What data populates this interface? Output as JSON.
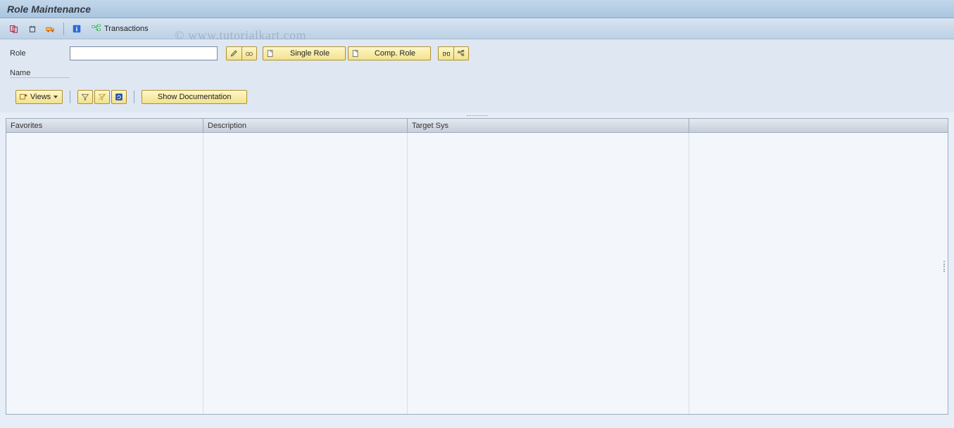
{
  "header": {
    "title": "Role Maintenance"
  },
  "toolbar": {
    "transactions_label": "Transactions"
  },
  "form": {
    "role_label": "Role",
    "role_value": "",
    "name_label": "Name",
    "single_role_label": "Single Role",
    "comp_role_label": "Comp. Role"
  },
  "sec_toolbar": {
    "views_label": "Views",
    "show_documentation_label": "Show Documentation"
  },
  "grid": {
    "columns": {
      "favorites": "Favorites",
      "description": "Description",
      "target_sys": "Target Sys"
    },
    "rows": []
  },
  "watermark": "© www.tutorialkart.com"
}
